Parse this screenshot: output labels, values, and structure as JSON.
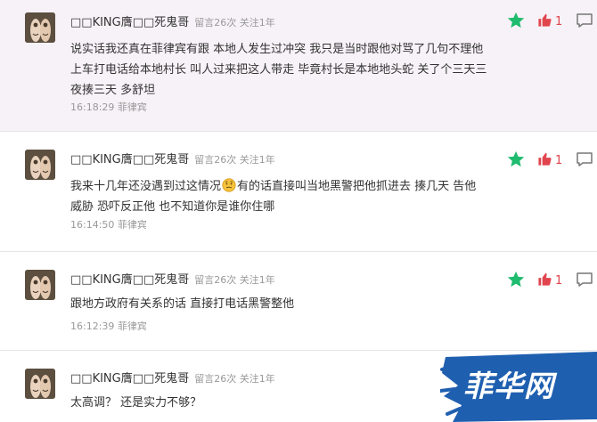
{
  "comments": [
    {
      "username": "□□KING膺□□死鬼哥",
      "stats": "留言26次 关注1年",
      "content": "说实话我还真在菲律宾有跟 本地人发生过冲突   我只是当时跟他对骂了几句不理他 上车打电话给本地村长  叫人过来把这人带走 毕竟村长是本地地头蛇 关了个三天三夜揍三天   多舒坦",
      "time": "16:18:29 菲律宾",
      "likes": "1",
      "like_color": "#e0454e",
      "star_color": "#1fbb6e"
    },
    {
      "username": "□□KING膺□□死鬼哥",
      "stats": "留言26次 关注1年",
      "content_before": "我来十几年还没遇到过这情况",
      "emoji": "thinking-face-emoji",
      "content_after": "有的话直接叫当地黑警把他抓进去 揍几天 告他 威胁 恐吓反正他 也不知道你是谁你住哪",
      "time": "16:14:50 菲律宾",
      "likes": "1"
    },
    {
      "username": "□□KING膺□□死鬼哥",
      "stats": "留言26次 关注1年",
      "content": "跟地方政府有关系的话 直接打电话黑警整他",
      "time": "16:12:39 菲律宾",
      "likes": "1"
    },
    {
      "username": "□□KING膺□□死鬼哥",
      "stats": "留言26次 关注1年",
      "content": "太高调？ 还是实力不够？",
      "time": "",
      "likes": ""
    }
  ],
  "watermark": {
    "text": "菲华网",
    "color": "#1f5fb0"
  }
}
